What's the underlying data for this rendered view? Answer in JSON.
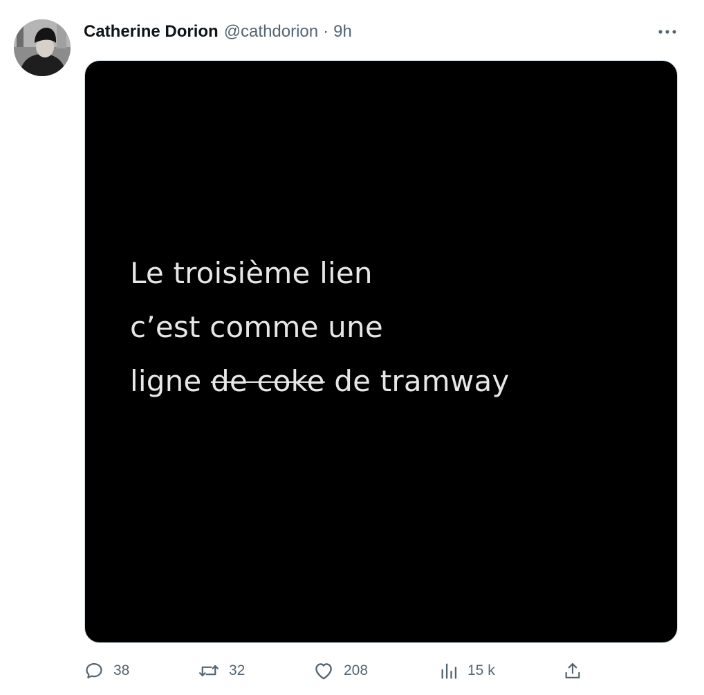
{
  "author": {
    "name": "Catherine Dorion",
    "handle": "@cathdorion",
    "separator": "·",
    "time": "9h"
  },
  "media": {
    "lines": [
      "Le troisième lien",
      "c’est comme une"
    ],
    "line3_start": "ligne ",
    "line3_struck": "de coke",
    "line3_end": " de tramway"
  },
  "actions": {
    "replies": "38",
    "retweets": "32",
    "likes": "208",
    "views": "15 k"
  },
  "icons": {
    "more": "more-horizontal-icon",
    "reply": "reply-icon",
    "retweet": "retweet-icon",
    "like": "heart-icon",
    "views": "views-chart-icon",
    "share": "share-icon"
  },
  "colors": {
    "text_primary": "#0f1419",
    "text_secondary": "#536471",
    "media_bg": "#000000",
    "media_text": "#e7e7e7"
  }
}
